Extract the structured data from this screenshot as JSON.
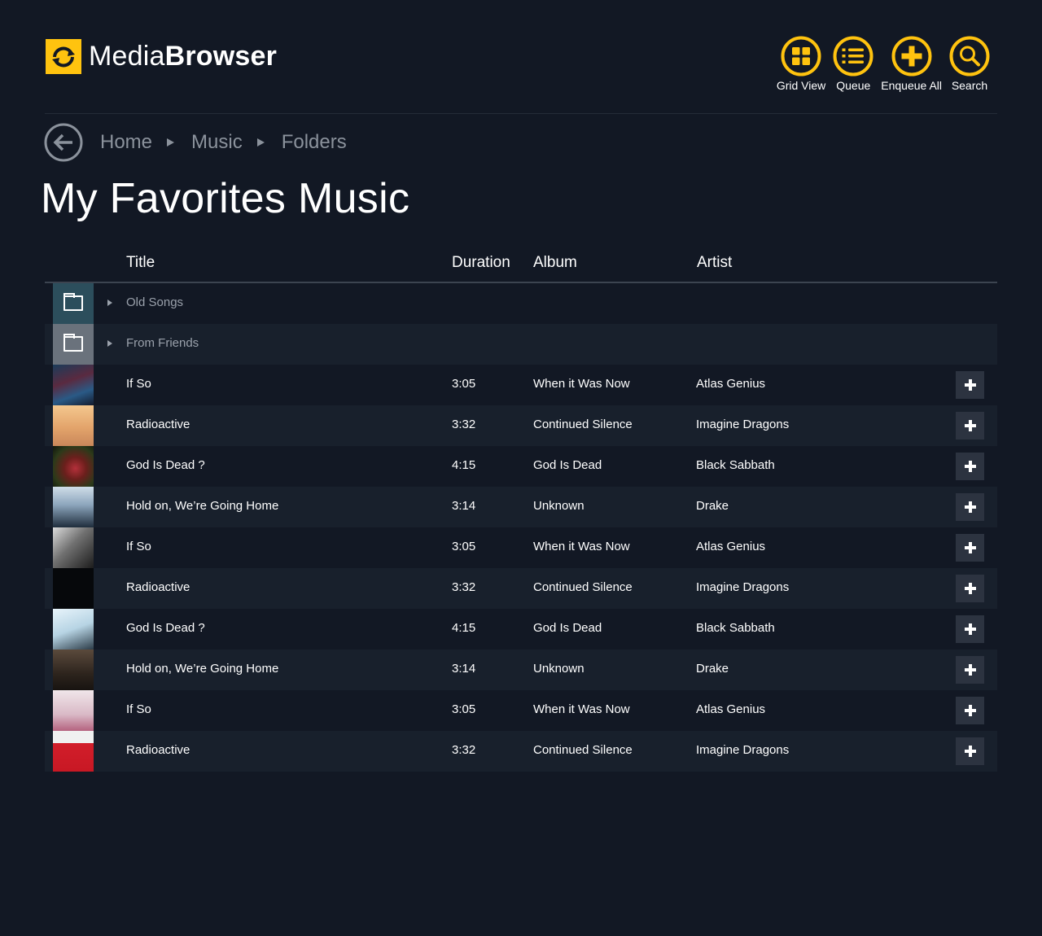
{
  "app": {
    "brand_light": "Media",
    "brand_bold": "Browser"
  },
  "toolbar": [
    {
      "label": "Grid View",
      "icon": "grid-icon"
    },
    {
      "label": "Queue",
      "icon": "queue-list-icon"
    },
    {
      "label": "Enqueue All",
      "icon": "plus-icon"
    },
    {
      "label": "Search",
      "icon": "search-icon"
    }
  ],
  "breadcrumb": [
    "Home",
    "Music",
    "Folders"
  ],
  "page_title": "My Favorites Music",
  "columns": {
    "title": "Title",
    "duration": "Duration",
    "album": "Album",
    "artist": "Artist"
  },
  "folders": [
    {
      "title": "Old Songs"
    },
    {
      "title": "From Friends"
    }
  ],
  "tracks": [
    {
      "title": "If So",
      "duration": "3:05",
      "album": "When it Was Now",
      "artist": "Atlas Genius"
    },
    {
      "title": "Radioactive",
      "duration": "3:32",
      "album": "Continued Silence",
      "artist": "Imagine Dragons"
    },
    {
      "title": "God Is Dead ?",
      "duration": "4:15",
      "album": "God Is Dead",
      "artist": "Black Sabbath"
    },
    {
      "title": "Hold on, We’re Going Home",
      "duration": "3:14",
      "album": "Unknown",
      "artist": "Drake"
    },
    {
      "title": "If So",
      "duration": "3:05",
      "album": "When it Was Now",
      "artist": "Atlas Genius"
    },
    {
      "title": "Radioactive",
      "duration": "3:32",
      "album": "Continued Silence",
      "artist": "Imagine Dragons"
    },
    {
      "title": "God Is Dead ?",
      "duration": "4:15",
      "album": "God Is Dead",
      "artist": "Black Sabbath"
    },
    {
      "title": "Hold on, We’re Going Home",
      "duration": "3:14",
      "album": "Unknown",
      "artist": "Drake"
    },
    {
      "title": "If So",
      "duration": "3:05",
      "album": "When it Was Now",
      "artist": "Atlas Genius"
    },
    {
      "title": "Radioactive",
      "duration": "3:32",
      "album": "Continued Silence",
      "artist": "Imagine Dragons"
    }
  ],
  "colors": {
    "background": "#121824",
    "accent": "#ffc30f",
    "row_alt": "#18202c",
    "muted_text": "#8b929c"
  }
}
